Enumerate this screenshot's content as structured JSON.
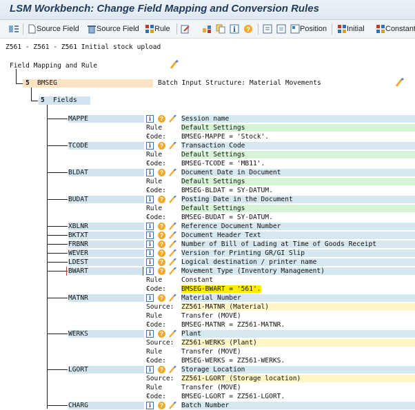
{
  "window": {
    "title": "LSM Workbench: Change Field Mapping and Conversion Rules"
  },
  "toolbar": {
    "source_field_1": "Source Field",
    "source_field_2": "Source Field",
    "rule": "Rule",
    "position": "Position",
    "initial": "Initial",
    "constant": "Constant"
  },
  "context": {
    "line": "Z561 - Z561 - Z561 Initial stock upload"
  },
  "tree": {
    "root_label": "Field Mapping and Rule",
    "structure": {
      "level": "5",
      "name": "BMSEG",
      "description": "Batch Input Structure: Material Movements"
    },
    "fields_node": {
      "level": "5",
      "label": "Fields"
    }
  },
  "labels": {
    "rule": "Rule :",
    "code": "Code:",
    "source": "Source:"
  },
  "fields": [
    {
      "name": "MAPPE",
      "desc": "Session name",
      "rule": "Default Settings",
      "code": "BMSEG-MAPPE = 'Stock'."
    },
    {
      "name": "TCODE",
      "desc": "Transaction Code",
      "rule": "Default Settings",
      "code": "BMSEG-TCODE = 'MB11'."
    },
    {
      "name": "BLDAT",
      "desc": "Document Date in Document",
      "rule": "Default Settings",
      "code": "BMSEG-BLDAT = SY-DATUM."
    },
    {
      "name": "BUDAT",
      "desc": "Posting Date in the Document",
      "rule": "Default Settings",
      "code": "BMSEG-BUDAT = SY-DATUM."
    },
    {
      "name": "XBLNR",
      "desc": "Reference Document Number"
    },
    {
      "name": "BKTXT",
      "desc": "Document Header Text"
    },
    {
      "name": "FRBNR",
      "desc": "Number of Bill of Lading at Time of Goods Receipt"
    },
    {
      "name": "WEVER",
      "desc": "Version for Printing GR/GI Slip"
    },
    {
      "name": "LDEST",
      "desc": "Logical destination / printer name"
    },
    {
      "name": "BWART",
      "desc": "Movement Type (Inventory Management)",
      "rule": "Constant",
      "code": "BMSEG-BWART = '561'."
    },
    {
      "name": "MATNR",
      "desc": "Material Number",
      "source": "ZZ561-MATNR (Material)",
      "rule": "Transfer (MOVE)",
      "code": "BMSEG-MATNR = ZZ561-MATNR."
    },
    {
      "name": "WERKS",
      "desc": "Plant",
      "source": "ZZ561-WERKS (Plant)",
      "rule": "Transfer (MOVE)",
      "code": "BMSEG-WERKS = ZZ561-WERKS."
    },
    {
      "name": "LGORT",
      "desc": "Storage Location",
      "source": "ZZ561-LGORT (Storage location)",
      "rule": "Transfer (MOVE)",
      "code": "BMSEG-LGORT = ZZ561-LGORT."
    },
    {
      "name": "CHARG",
      "desc": "Batch Number"
    }
  ]
}
